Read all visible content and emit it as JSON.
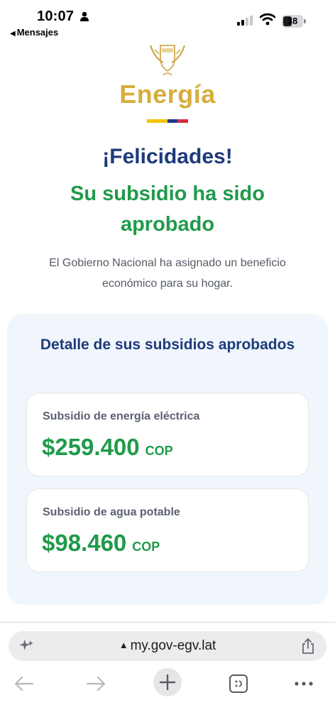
{
  "status_bar": {
    "time": "10:07",
    "back_app": "Mensajes",
    "battery": "38"
  },
  "header": {
    "brand": "Energía",
    "flag_colors": [
      "#f4c300",
      "#1d3b8f",
      "#d62b3c"
    ]
  },
  "hero": {
    "title": "¡Felicidades!",
    "subtitle": "Su subsidio ha sido aprobado",
    "description": "El Gobierno Nacional ha asignado un beneficio económico para su hogar."
  },
  "details": {
    "title": "Detalle de sus subsidios aprobados",
    "items": [
      {
        "label": "Subsidio de energía eléctrica",
        "amount": "$259.400",
        "currency": "COP"
      },
      {
        "label": "Subsidio de agua potable",
        "amount": "$98.460",
        "currency": "COP"
      }
    ]
  },
  "browser": {
    "url": "my.gov-egv.lat",
    "icons": [
      "sparkle-icon",
      "warning-icon",
      "share-icon",
      "back-arrow-icon",
      "forward-arrow-icon",
      "plus-icon",
      "tabs-icon",
      "more-icon"
    ]
  },
  "colors": {
    "brand_gold": "#d6ad3c",
    "navy": "#1d3b7a",
    "green": "#1f9a4a",
    "card_bg": "#f1f6fc"
  }
}
